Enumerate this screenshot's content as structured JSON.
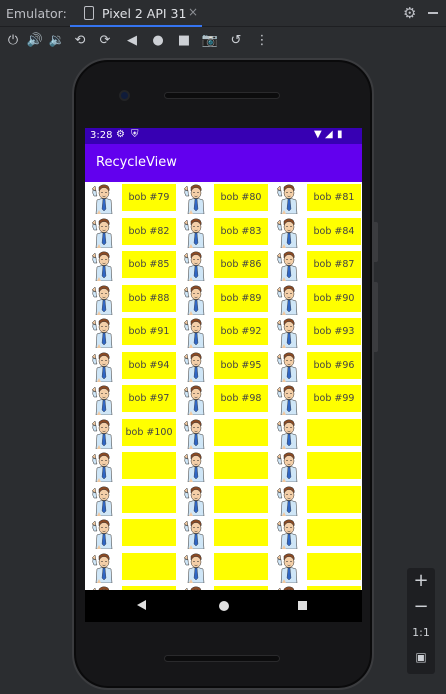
{
  "titlebar": {
    "label": "Emulator:",
    "tab_label": "Pixel 2 API 31",
    "close_glyph": "×"
  },
  "toolbar_icons": [
    "power-icon",
    "volume-up-icon",
    "volume-down-icon",
    "rotate-left-icon",
    "rotate-right-icon",
    "back-icon",
    "home-icon",
    "overview-icon",
    "screenshot-icon",
    "snapshot-icon",
    "more-icon"
  ],
  "device": {
    "statusbar": {
      "time": "3:28"
    },
    "appbar": {
      "title": "RecycleView"
    },
    "rows": [
      [
        "bob #79",
        "bob #80",
        "bob #81"
      ],
      [
        "bob #82",
        "bob #83",
        "bob #84"
      ],
      [
        "bob #85",
        "bob #86",
        "bob #87"
      ],
      [
        "bob #88",
        "bob #89",
        "bob #90"
      ],
      [
        "bob #91",
        "bob #92",
        "bob #93"
      ],
      [
        "bob #94",
        "bob #95",
        "bob #96"
      ],
      [
        "bob #97",
        "bob #98",
        "bob #99"
      ],
      [
        "bob #100",
        "",
        ""
      ],
      [
        "",
        "",
        ""
      ],
      [
        "",
        "",
        ""
      ],
      [
        "",
        "",
        ""
      ],
      [
        "",
        "",
        ""
      ],
      [
        "",
        "",
        ""
      ]
    ]
  },
  "zoom": {
    "plus": "+",
    "minus": "−",
    "one_to_one": "1:1"
  },
  "colors": {
    "appbar": "#6200ee",
    "statusbar": "#3700b3",
    "cell": "#ffff00"
  }
}
